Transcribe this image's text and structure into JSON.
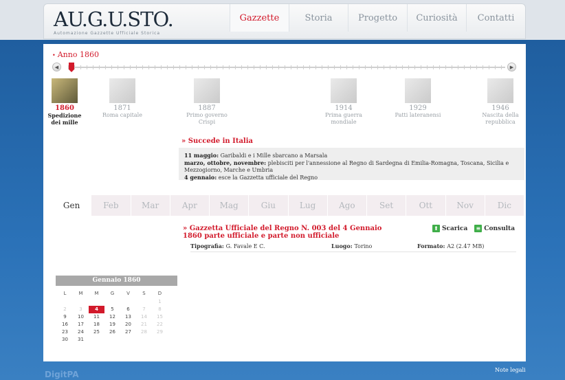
{
  "logo": {
    "main": "AU.G.U.STO.",
    "sub": "Automazione Gazzette Ufficiale Storica"
  },
  "nav": [
    "Gazzette",
    "Storia",
    "Progetto",
    "Curiosità",
    "Contatti"
  ],
  "year_title": "Anno 1860",
  "timeline": [
    {
      "year": "1860",
      "label": "Spedizione dei mille"
    },
    {
      "year": "1871",
      "label": "Roma capitale"
    },
    {
      "year": "1887",
      "label": "Primo governo Crispi"
    },
    {
      "year": "1914",
      "label": "Prima guerra mondiale"
    },
    {
      "year": "1929",
      "label": "Patti lateranensi"
    },
    {
      "year": "1946",
      "label": "Nascita della repubblica"
    }
  ],
  "succede": {
    "title": "Succede in Italia",
    "lines": [
      {
        "date": "11 maggio:",
        "text": " Garibaldi e i Mille sbarcano a Marsala"
      },
      {
        "date": "marzo, ottobre, novembre:",
        "text": " plebisciti per l'annessione al Regno di Sardegna di Emilia-Romagna, Toscana, Sicilia e Mezzogiorno, Marche e Umbria"
      },
      {
        "date": "4 gennaio:",
        "text": " esce la Gazzetta ufficiale del Regno"
      }
    ]
  },
  "months": [
    "Gen",
    "Feb",
    "Mar",
    "Apr",
    "Mag",
    "Giu",
    "Lug",
    "Ago",
    "Set",
    "Ott",
    "Nov",
    "Dic"
  ],
  "gazzetta": {
    "title": "Gazzetta Ufficiale del Regno N. 003 del 4 Gennaio 1860 parte ufficiale e parte non ufficiale",
    "scarica": "Scarica",
    "consulta": "Consulta",
    "tipografia_label": "Tipografia:",
    "tipografia": "G. Favale E C.",
    "luogo_label": "Luogo:",
    "luogo": "Torino",
    "formato_label": "Formato:",
    "formato": "A2 (2.47 MB)"
  },
  "calendar": {
    "title": "Gennaio 1860",
    "dow": [
      "L",
      "M",
      "M",
      "G",
      "V",
      "S",
      "D"
    ],
    "rows": [
      [
        "",
        "",
        "",
        "",
        "",
        "",
        "1"
      ],
      [
        "2",
        "3",
        "4",
        "5",
        "6",
        "7",
        "8"
      ],
      [
        "9",
        "10",
        "11",
        "12",
        "13",
        "14",
        "15"
      ],
      [
        "16",
        "17",
        "18",
        "19",
        "20",
        "21",
        "22"
      ],
      [
        "23",
        "24",
        "25",
        "26",
        "27",
        "28",
        "29"
      ],
      [
        "30",
        "31",
        "",
        "",
        "",
        "",
        ""
      ]
    ],
    "selected": "4"
  },
  "footer": {
    "note": "Note legali",
    "brand": "DigitPA"
  },
  "colors": {
    "accent": "#d21a2b",
    "background": "#2a6aad"
  }
}
